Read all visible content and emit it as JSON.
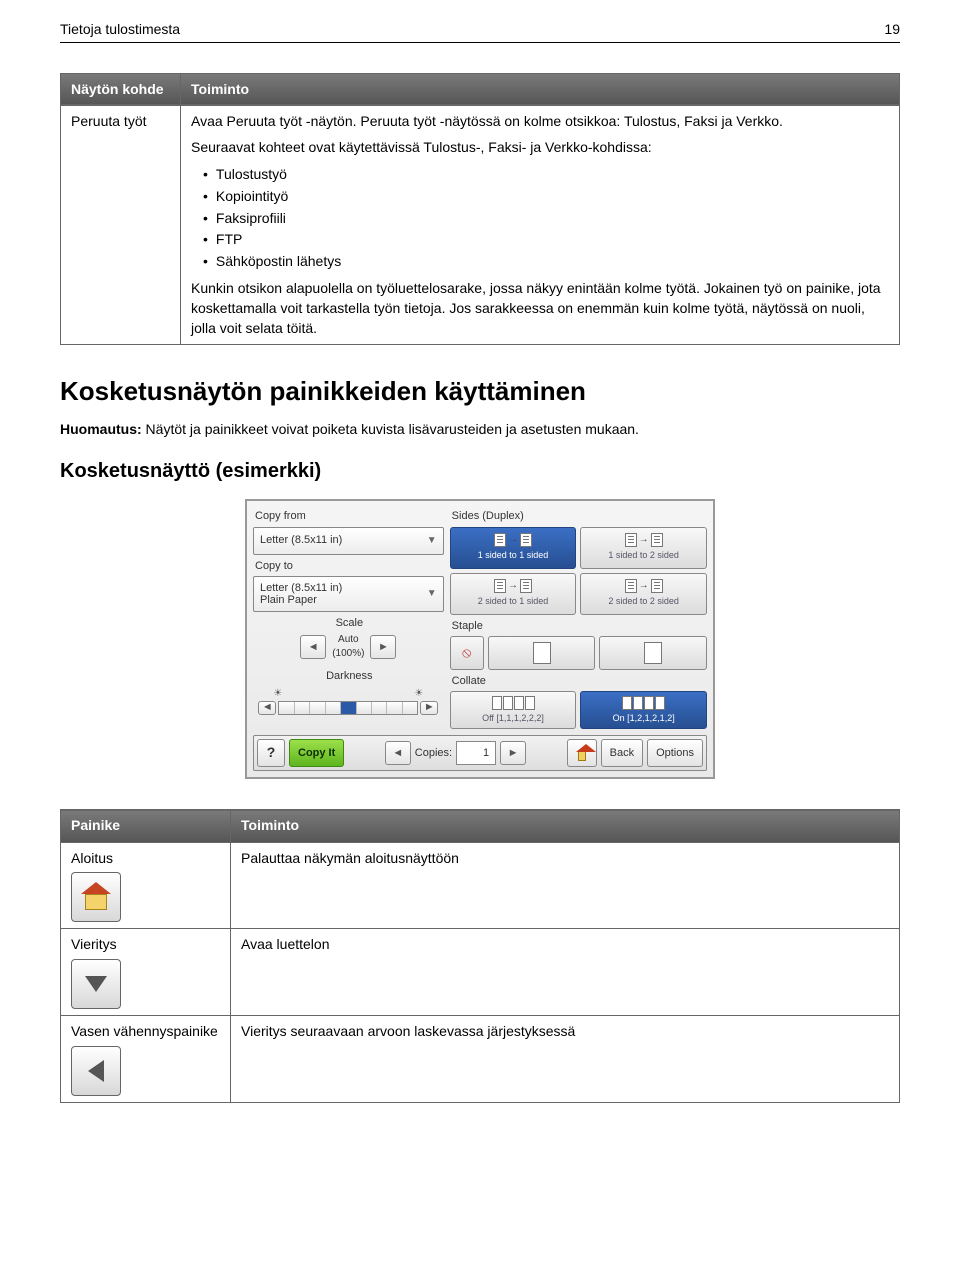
{
  "header": {
    "title": "Tietoja tulostimesta",
    "page": "19"
  },
  "table1": {
    "col1": "Näytön kohde",
    "col2": "Toiminto",
    "row_label": "Peruuta työt",
    "para1": "Avaa Peruuta työt -näytön. Peruuta työt -näytössä on kolme otsikkoa: Tulostus, Faksi ja Verkko.",
    "para2": "Seuraavat kohteet ovat käytettävissä Tulostus-, Faksi- ja Verkko-kohdissa:",
    "bullets": [
      "Tulostustyö",
      "Kopiointityö",
      "Faksiprofiili",
      "FTP",
      "Sähköpostin lähetys"
    ],
    "para3": "Kunkin otsikon alapuolella on työluettelosarake, jossa näkyy enintään kolme työtä. Jokainen työ on painike, jota koskettamalla voit tarkastella työn tietoja. Jos sarakkeessa on enemmän kuin kolme työtä, näytössä on nuoli, jolla voit selata töitä."
  },
  "h1": "Kosketusnäytön painikkeiden käyttäminen",
  "note_strong": "Huomautus:",
  "note_text": " Näytöt ja painikkeet voivat poiketa kuvista lisävarusteiden ja asetusten mukaan.",
  "h2": "Kosketusnäyttö (esimerkki)",
  "screen": {
    "copy_from_label": "Copy from",
    "copy_from_value": "Letter (8.5x11 in)",
    "copy_to_label": "Copy to",
    "copy_to_line1": "Letter (8.5x11 in)",
    "copy_to_line2": "Plain Paper",
    "scale_label": "Scale",
    "scale_value": "Auto\n(100%)",
    "darkness_label": "Darkness",
    "sides_label": "Sides (Duplex)",
    "sides_opts": [
      "1 sided to 1 sided",
      "1 sided to 2 sided",
      "2 sided to 1 sided",
      "2 sided to 2 sided"
    ],
    "staple_label": "Staple",
    "collate_label": "Collate",
    "collate_opts": [
      "Off [1,1,1,2,2,2]",
      "On [1,2,1,2,1,2]"
    ],
    "copyit": "Copy It",
    "copies_label": "Copies:",
    "copies_value": "1",
    "back": "Back",
    "options": "Options"
  },
  "table2": {
    "col1": "Painike",
    "col2": "Toiminto",
    "rows": [
      {
        "name": "Aloitus",
        "desc": "Palauttaa näkymän aloitusnäyttöön"
      },
      {
        "name": "Vieritys",
        "desc": "Avaa luettelon"
      },
      {
        "name": "Vasen vähennyspainike",
        "desc": "Vieritys seuraavaan arvoon laskevassa järjestyksessä"
      }
    ]
  }
}
